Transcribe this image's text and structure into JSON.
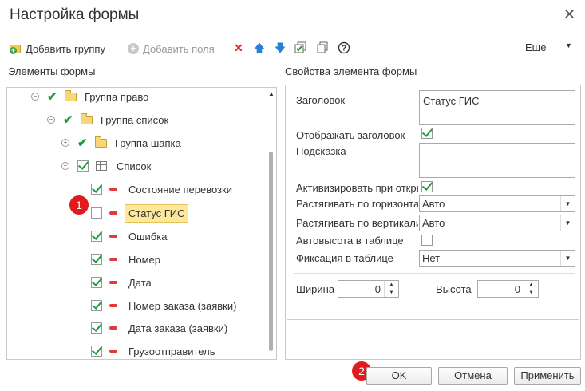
{
  "window": {
    "title": "Настройка формы"
  },
  "toolbar": {
    "add_group": "Добавить группу",
    "add_field": "Добавить поля",
    "more": "Еще"
  },
  "left_panel": {
    "label": "Элементы формы"
  },
  "right_panel": {
    "label": "Свойства элемента формы"
  },
  "tree": {
    "items": [
      {
        "label": "Группа право"
      },
      {
        "label": "Группа список"
      },
      {
        "label": "Группа шапка"
      },
      {
        "label": "Список"
      },
      {
        "label": "Состояние перевозки",
        "checked": true
      },
      {
        "label": "Статус ГИС",
        "checked": false,
        "selected": true
      },
      {
        "label": "Ошибка",
        "checked": true
      },
      {
        "label": "Номер",
        "checked": true
      },
      {
        "label": "Дата",
        "checked": true
      },
      {
        "label": "Номер заказа (заявки)",
        "checked": true
      },
      {
        "label": "Дата заказа (заявки)",
        "checked": true
      },
      {
        "label": "Грузоотправитель",
        "checked": true
      }
    ]
  },
  "props": {
    "title_label": "Заголовок",
    "title_value": "Статус ГИС",
    "show_title_label": "Отображать заголовок",
    "hint_label": "Подсказка",
    "activate_label": "Активизировать при открытии",
    "stretch_h_label": "Растягивать по горизонтали",
    "stretch_h_value": "Авто",
    "stretch_v_label": "Растягивать по вертикали",
    "stretch_v_value": "Авто",
    "autoheight_label": "Автовысота в таблице",
    "fix_label": "Фиксация в таблице",
    "fix_value": "Нет",
    "width_label": "Ширина",
    "width_value": "0",
    "height_label": "Высота",
    "height_value": "0"
  },
  "buttons": {
    "ok": "OK",
    "cancel": "Отмена",
    "apply": "Применить"
  },
  "badges": {
    "one": "1",
    "two": "2"
  },
  "colors": {
    "accent_check": "#1a9e3a",
    "badge": "#e01b1b",
    "selection": "#fde79a"
  }
}
